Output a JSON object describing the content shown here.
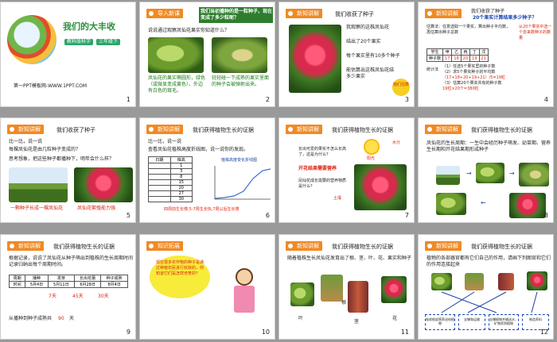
{
  "s1": {
    "title": "我们的大丰收",
    "tag1": "教科版科学",
    "tag2": "三年级下",
    "footer": "第一PPT模板网-WWW.1PPT.COM",
    "num": "1"
  },
  "s2": {
    "tag": "导入新课",
    "heading": "我们当初播种的是一粒种子，现在变成了多少粒呢？",
    "line1": "说说通过观察凤仙花果实你知道什么？",
    "cap1": "凤仙花的果实椭圆形，绿色（或微显变成黄色），外边有白色的茸毛。",
    "cap2": "轻轻碰一下成熟的果实里面的种子会被弹射出来。",
    "num": "2"
  },
  "s3": {
    "tag": "新知讲解",
    "heading": "我们收获了种子",
    "line1": "我观察的这株凤仙花",
    "line2": "结出了20个果实",
    "line3": "每个果实里有10多个种子",
    "line4": "能估算出这株凤仙花结多少果实",
    "badge": "我们估算",
    "num": "3"
  },
  "s4": {
    "tag": "新知讲解",
    "heading": "我们收获了种子",
    "q": "20个果实计算结果多少种子？",
    "l1": "估算法：任意选取一个果实，算出种子平均数，",
    "l2": "再估算出种子总数",
    "note": "从20个果实中选一个去来数种子的数量",
    "tbl_head": [
      "学生",
      "甲",
      "乙",
      "丙",
      "丁",
      "戊"
    ],
    "tbl_row": [
      "种子数",
      "17",
      "18",
      "20",
      "19",
      "21"
    ],
    "c1": "（1）任选5个果实里的种子数",
    "c2": "（2）求5个果实种子的平均数",
    "c3": "（17+18+20+19+21）/5=19粒",
    "c4": "（3）估算20个果实共有的种子数",
    "c5": "19粒×20个=380粒",
    "side": "统计法",
    "num": "4"
  },
  "s5": {
    "tag": "新知讲解",
    "heading": "我们收获了种子",
    "l1": "比一比，说一说",
    "l2": "每棵凤仙花是由几粒种子变成的？",
    "l3": "思考想象，把这些种子都播种下，明年会什么样？",
    "cap1": "一颗种子长成一棵凤仙花",
    "cap2": "凤仙花繁殖能力强",
    "num": "5"
  },
  "s6": {
    "tag": "新知讲解",
    "heading": "我们获得植物生长的证据",
    "l1": "比一比，说一说",
    "l2": "查看凤仙花植株高度折线图，说一说你的发现。",
    "chart_title": "植株高度变化折线图",
    "col1": "日期",
    "col2": "株高",
    "rows": [
      "1",
      "3",
      "8",
      "15",
      "20",
      "27",
      "30"
    ],
    "cap": "四周前生长慢,5-7周生长快,7周以后生长慢",
    "num": "6"
  },
  "s7": {
    "tag": "新知讲解",
    "heading": "我们获得植物生长的证据",
    "l1": "长出可爱的果实不怎么长高了，这是为什么？",
    "l2": "开花结果需要营养",
    "l3": "凤仙花成长需要的营养物质是什么？",
    "lbl1": "阳光",
    "lbl2": "水分",
    "lbl3": "土壤",
    "num": "7"
  },
  "s8": {
    "tag": "新知讲解",
    "heading": "我们获得植物生长的证据",
    "l1": "凤仙花的生长周期：一生中会经历种子萌发、幼苗期、营养生长期和开花结果期形成种子",
    "num": "8"
  },
  "s9": {
    "tag": "新知讲解",
    "heading": "我们获得植物生长的证据",
    "l1": "根据记录，说说了凤仙花从种子萌出到植株的生长周期时间记录归纳出每个周期时间。",
    "tbl_head": [
      "周期",
      "播种",
      "发芽",
      "长出花蕾",
      "种子成熟"
    ],
    "tbl_row": [
      "时间",
      "5月4日",
      "5月11日",
      "6月28日",
      "8月4日"
    ],
    "d1": "7天",
    "d2": "45天",
    "d3": "30天",
    "footer": "从播种到种子成熟共",
    "total": "90",
    "unit": "天",
    "num": "9"
  },
  "s10": {
    "tag": "知识拓展",
    "bubble": "现在很多农作物的种子是通过种植农民进行收获的，你知道它们是怎样培育的？",
    "num": "10"
  },
  "s11": {
    "tag": "新知讲解",
    "heading": "我们获得植物生长的证据",
    "l1": "随着植株生长凤仙花发育出了根、茎、叶、花、果实和种子",
    "labels": [
      "叶",
      "根",
      "茎",
      "花"
    ],
    "num": "11"
  },
  "s12": {
    "tag": "新知讲解",
    "heading": "我们获得植物生长的证据",
    "l1": "植物的各部器官都有它们自己的作用，请画下列图官和它们的作用连接起来",
    "boxes": [
      "吸收根部营养送给植物",
      "支撑和运输",
      "支撑植物并输送水、矿物质到植物",
      "制造养料"
    ],
    "num": "12"
  }
}
